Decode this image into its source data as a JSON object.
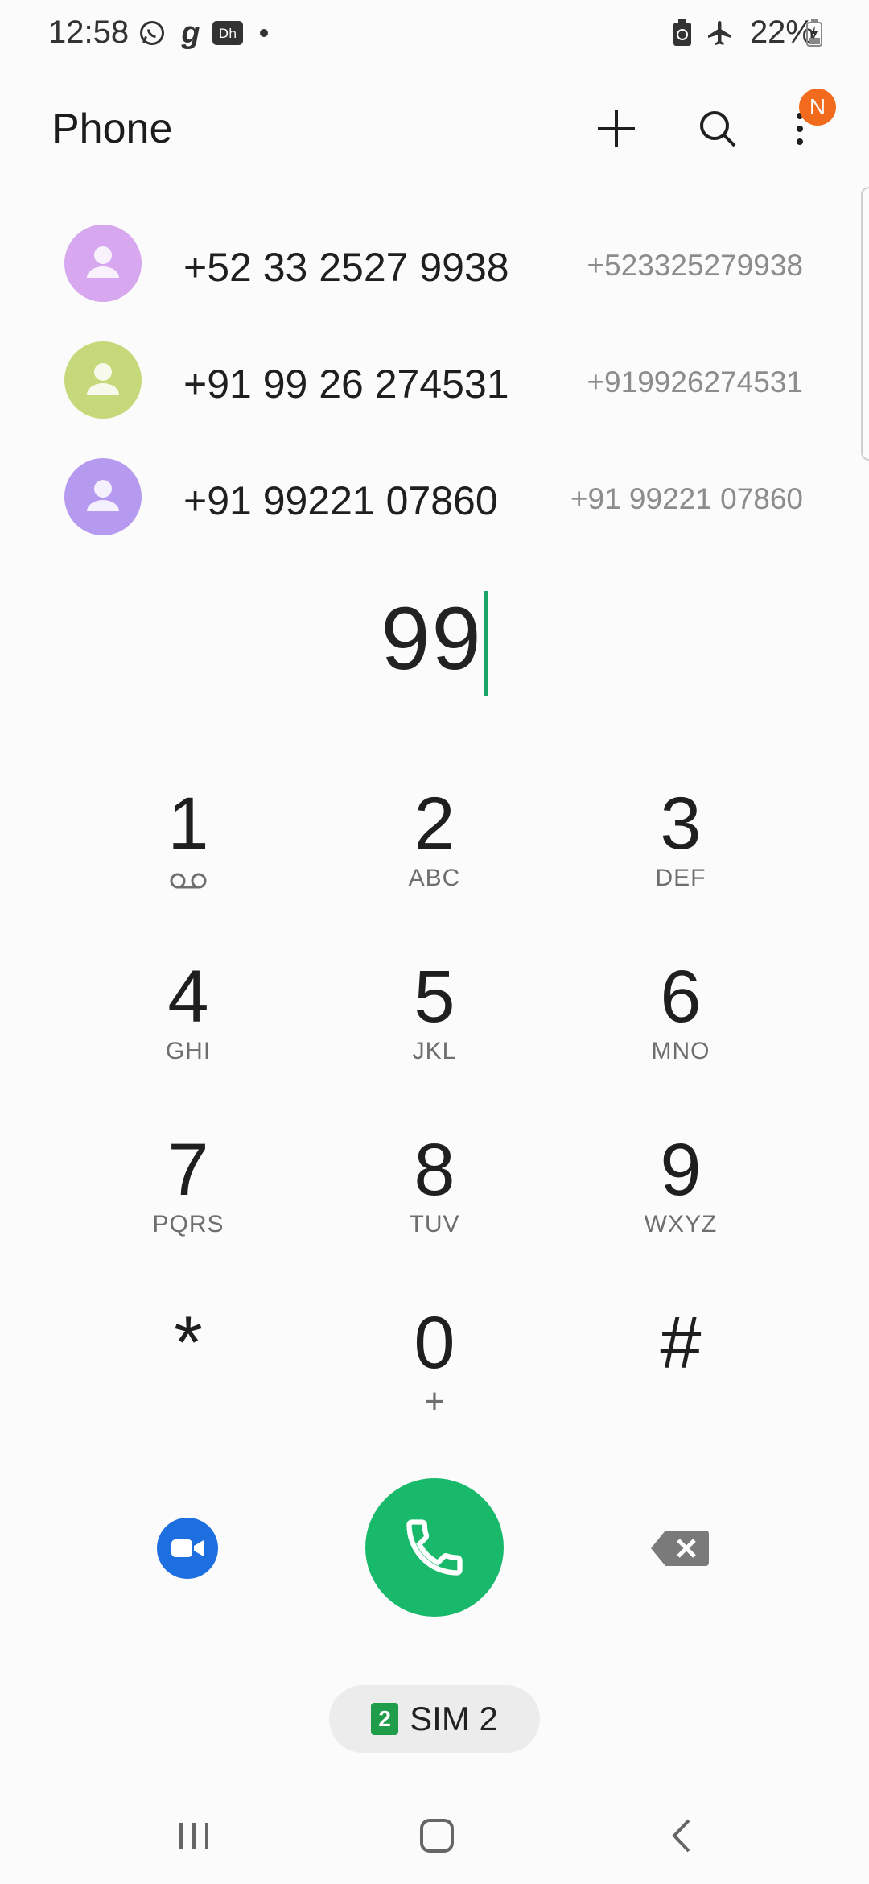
{
  "status_bar": {
    "time": "12:58",
    "battery_percent": "22%",
    "left_icons": [
      "whatsapp-icon",
      "gaana-icon",
      "hotstar-icon",
      "more-dot-icon"
    ],
    "right_icons": [
      "battery-saver-icon",
      "airplane-mode-icon",
      "battery-charging-icon"
    ]
  },
  "app_bar": {
    "title": "Phone",
    "notification_badge": "N",
    "actions": [
      "add-icon",
      "search-icon",
      "more-options-icon"
    ]
  },
  "suggestions": [
    {
      "name": "+52 33 2527 9938",
      "number": "+523325279938",
      "avatar_color": "#d7a8ef"
    },
    {
      "name": "+91 99 26 274531",
      "number": "+919926274531",
      "avatar_color": "#c6d97a"
    },
    {
      "name": "+91 99221 07860",
      "number": "+91 99221 07860",
      "avatar_color": "#b69af0"
    }
  ],
  "dialer": {
    "entered_number": "99"
  },
  "keypad": [
    [
      {
        "digit": "1",
        "letters": "",
        "sub": "voicemail-icon"
      },
      {
        "digit": "2",
        "letters": "ABC"
      },
      {
        "digit": "3",
        "letters": "DEF"
      }
    ],
    [
      {
        "digit": "4",
        "letters": "GHI"
      },
      {
        "digit": "5",
        "letters": "JKL"
      },
      {
        "digit": "6",
        "letters": "MNO"
      }
    ],
    [
      {
        "digit": "7",
        "letters": "PQRS"
      },
      {
        "digit": "8",
        "letters": "TUV"
      },
      {
        "digit": "9",
        "letters": "WXYZ"
      }
    ],
    [
      {
        "digit": "*",
        "letters": ""
      },
      {
        "digit": "0",
        "letters": "+"
      },
      {
        "digit": "#",
        "letters": ""
      }
    ]
  ],
  "actions": {
    "video_call_icon": "video-call-icon",
    "call_icon": "phone-call-icon",
    "backspace_icon": "backspace-icon"
  },
  "sim": {
    "number": "2",
    "label": "SIM 2"
  },
  "colors": {
    "accent_green": "#18b96b",
    "caret": "#1aa56a",
    "video_blue": "#1d6fe0",
    "badge_orange": "#f26a1b"
  },
  "nav_bar": [
    "recents-icon",
    "home-icon",
    "back-icon"
  ]
}
